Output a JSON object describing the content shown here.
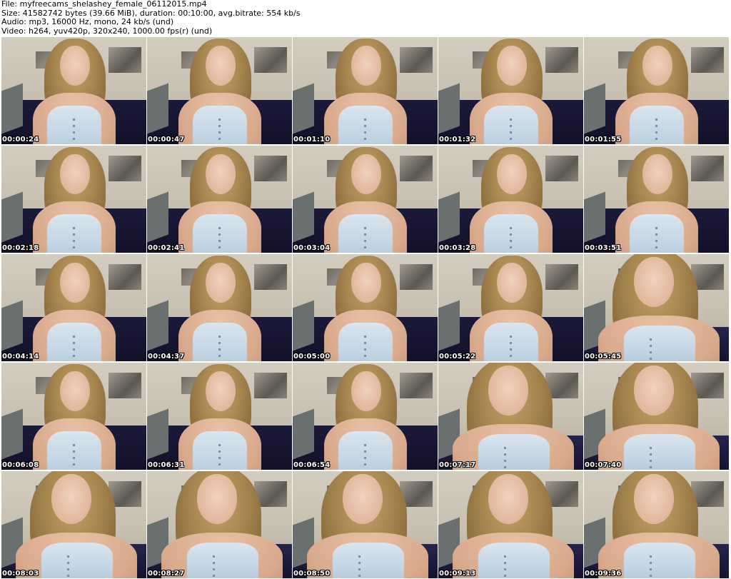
{
  "header": {
    "file_line": "File: myfreecams_shelashey_female_06112015.mp4",
    "size_line": "Size: 41582742 bytes (39.66 MiB), duration: 00:10:00, avg.bitrate: 554 kb/s",
    "audio_line": "Audio: mp3, 16000 Hz, mono, 24 kb/s (und)",
    "video_line": "Video: h264, yuv420p, 320x240, 1000.00 fps(r) (und)"
  },
  "thumbnails": [
    {
      "timestamp": "00:00:24"
    },
    {
      "timestamp": "00:00:47"
    },
    {
      "timestamp": "00:01:10"
    },
    {
      "timestamp": "00:01:32"
    },
    {
      "timestamp": "00:01:55"
    },
    {
      "timestamp": "00:02:18"
    },
    {
      "timestamp": "00:02:41"
    },
    {
      "timestamp": "00:03:04"
    },
    {
      "timestamp": "00:03:28"
    },
    {
      "timestamp": "00:03:51"
    },
    {
      "timestamp": "00:04:14"
    },
    {
      "timestamp": "00:04:37"
    },
    {
      "timestamp": "00:05:00"
    },
    {
      "timestamp": "00:05:22"
    },
    {
      "timestamp": "00:05:45"
    },
    {
      "timestamp": "00:06:08"
    },
    {
      "timestamp": "00:06:31"
    },
    {
      "timestamp": "00:06:54"
    },
    {
      "timestamp": "00:07:17"
    },
    {
      "timestamp": "00:07:40"
    },
    {
      "timestamp": "00:08:03"
    },
    {
      "timestamp": "00:08:27"
    },
    {
      "timestamp": "00:08:50"
    },
    {
      "timestamp": "00:09:13"
    },
    {
      "timestamp": "00:09:36"
    }
  ]
}
